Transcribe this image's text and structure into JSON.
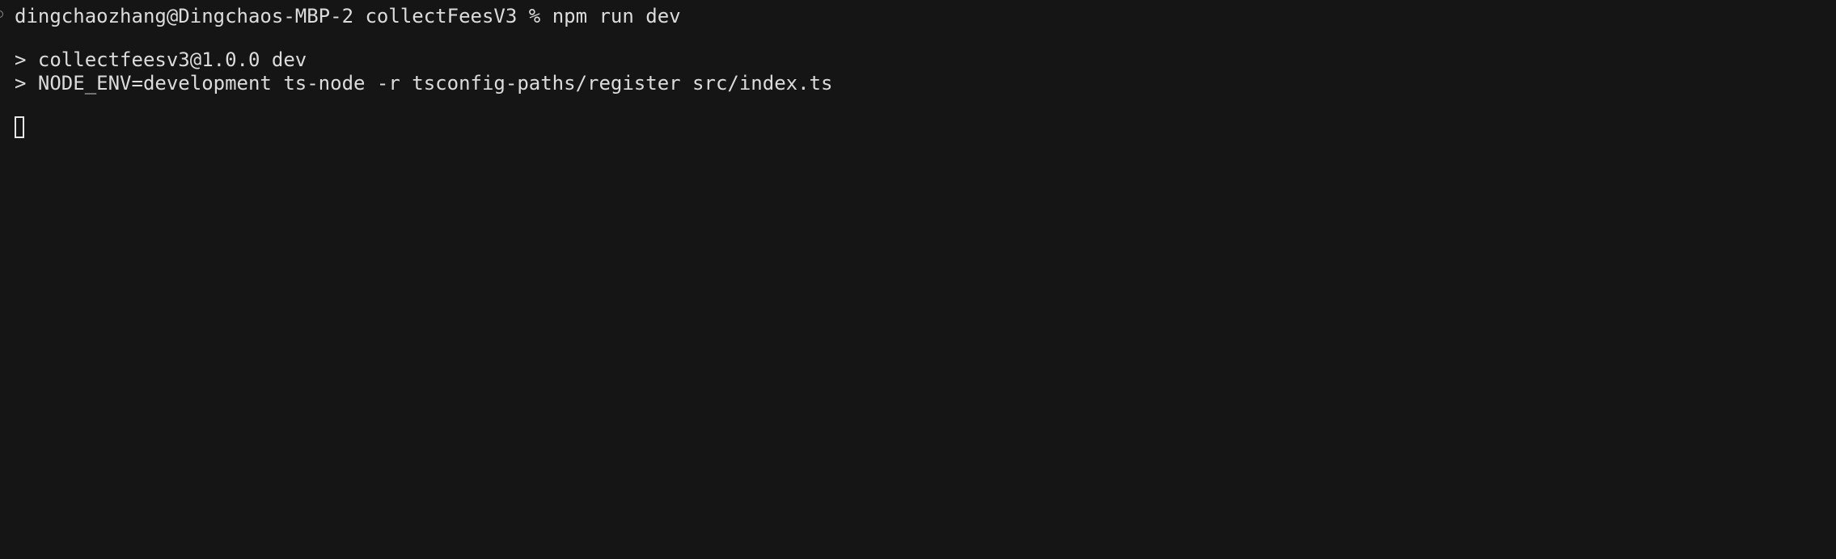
{
  "terminal": {
    "prompt": {
      "user_host": "dingchaozhang@Dingchaos-MBP-2",
      "directory": "collectFeesV3",
      "symbol": "%",
      "command": "npm run dev"
    },
    "output": {
      "line1": "> collectfeesv3@1.0.0 dev",
      "line2": "> NODE_ENV=development ts-node -r tsconfig-paths/register src/index.ts"
    },
    "icons": {
      "prompt_mark": "command-mark-icon",
      "cursor": "block-cursor-icon"
    },
    "colors": {
      "background": "#151515",
      "text": "#dcdcdc"
    }
  }
}
